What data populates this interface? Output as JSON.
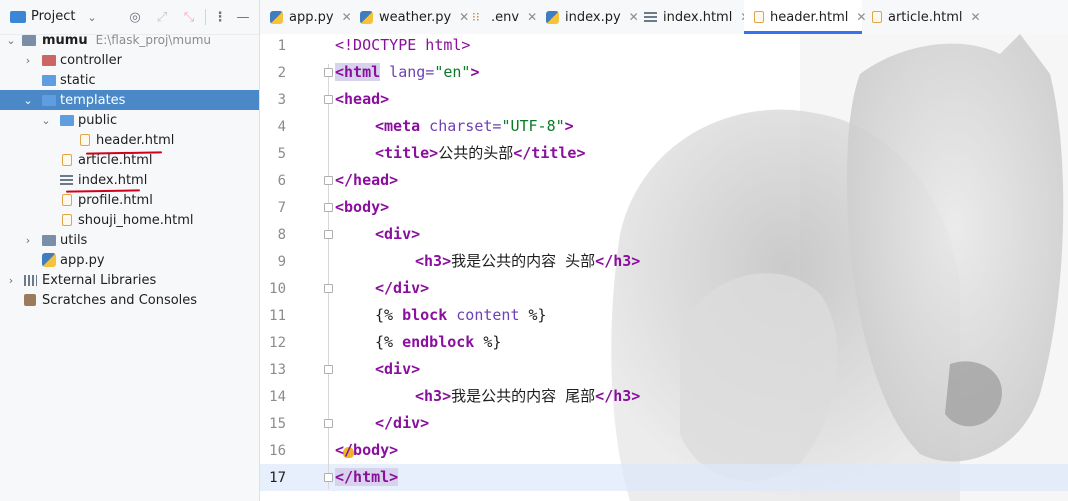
{
  "project_panel": {
    "title": "Project",
    "tree": [
      {
        "label": "mumu",
        "path": "E:\\flask_proj\\mumu"
      },
      {
        "label": "controller"
      },
      {
        "label": "static"
      },
      {
        "label": "templates"
      },
      {
        "label": "public"
      },
      {
        "label": "header.html"
      },
      {
        "label": "article.html"
      },
      {
        "label": "index.html"
      },
      {
        "label": "profile.html"
      },
      {
        "label": "shouji_home.html"
      },
      {
        "label": "utils"
      },
      {
        "label": "app.py"
      },
      {
        "label": "External Libraries"
      },
      {
        "label": "Scratches and Consoles"
      }
    ]
  },
  "tabs": [
    {
      "label": "app.py",
      "active": false
    },
    {
      "label": "weather.py",
      "active": false
    },
    {
      "label": ".env",
      "active": false
    },
    {
      "label": "index.py",
      "active": false
    },
    {
      "label": "index.html",
      "active": false
    },
    {
      "label": "header.html",
      "active": true
    },
    {
      "label": "article.html",
      "active": false
    }
  ],
  "editor": {
    "line_numbers": [
      "1",
      "2",
      "3",
      "4",
      "5",
      "6",
      "7",
      "8",
      "9",
      "10",
      "11",
      "12",
      "13",
      "14",
      "15",
      "16",
      "17"
    ],
    "current_line": 17,
    "code": {
      "l1_doctype": "<!DOCTYPE html>",
      "l2_open": "<html",
      "l2_attr": " lang=",
      "l2_val": "\"en\"",
      "l2_close": ">",
      "l3": "<head>",
      "l4_open": "<meta",
      "l4_attr": " charset=",
      "l4_val": "\"UTF-8\"",
      "l4_close": ">",
      "l5_open": "<title>",
      "l5_text": "公共的头部",
      "l5_close": "</title>",
      "l6": "</head>",
      "l7": "<body>",
      "l8": "<div>",
      "l9_open": "<h3>",
      "l9_text": "我是公共的内容 头部",
      "l9_close": "</h3>",
      "l10": "</div>",
      "l11_a": "{%",
      "l11_b": " block",
      "l11_c": " content",
      "l11_d": " %}",
      "l12_a": "{%",
      "l12_b": " endblock",
      "l12_c": " %}",
      "l13": "<div>",
      "l14_open": "<h3>",
      "l14_text": "我是公共的内容 尾部",
      "l14_close": "</h3>",
      "l15": "</div>",
      "l16": "</body>",
      "l17": "</html>"
    }
  },
  "colors": {
    "selection": "#4a88c7",
    "tab_active_underline": "#3574f0",
    "annotation_underline": "#d0021b"
  }
}
